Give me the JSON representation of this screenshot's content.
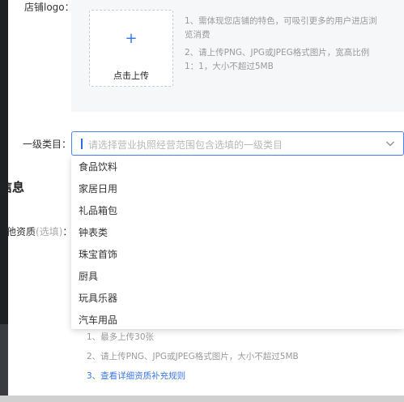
{
  "logo_section": {
    "label": "店铺logo：",
    "upload_plus": "+",
    "upload_text": "点击上传",
    "hint_1": "1、需体现您店铺的特色，可吸引更多的用户进店浏览消费",
    "hint_2": "2、请上传PNG、JPG或JPEG格式图片，宽高比例1：1，大小不超过5MB"
  },
  "category": {
    "label": "一级类目：",
    "placeholder": "请选择营业执照经营范围包含选填的一级类目",
    "options": [
      "食品饮料",
      "家居日用",
      "礼品箱包",
      "钟表类",
      "珠宝首饰",
      "厨具",
      "玩具乐器",
      "汽车用品"
    ]
  },
  "section": {
    "title": "信息"
  },
  "qualification": {
    "label": "他资质",
    "optional": "(选填)",
    "colon": "：",
    "hint_1": "1、最多上传30张",
    "hint_2": "2、请上传PNG、JPG或JPEG格式图片，大小不超过5MB",
    "hint_3": "3、查看详细资质补充规则"
  },
  "colors": {
    "accent": "#3b77e8",
    "border_active": "#4a86f0"
  }
}
